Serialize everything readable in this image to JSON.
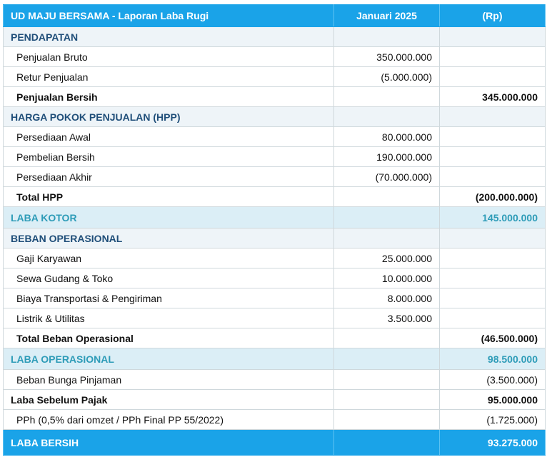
{
  "header": {
    "title": "UD MAJU BERSAMA - Laporan Laba Rugi",
    "period": "Januari 2025",
    "currency": "(Rp)"
  },
  "rows": [
    {
      "kind": "section",
      "label": "PENDAPATAN",
      "detail": "",
      "total": ""
    },
    {
      "kind": "item",
      "label": "Penjualan Bruto",
      "detail": "350.000.000",
      "total": ""
    },
    {
      "kind": "item",
      "label": "Retur Penjualan",
      "detail": "(5.000.000)",
      "total": ""
    },
    {
      "kind": "total",
      "label": "Penjualan Bersih",
      "detail": "",
      "total": "345.000.000"
    },
    {
      "kind": "section",
      "label": "HARGA POKOK PENJUALAN (HPP)",
      "detail": "",
      "total": ""
    },
    {
      "kind": "item",
      "label": "Persediaan Awal",
      "detail": "80.000.000",
      "total": ""
    },
    {
      "kind": "item",
      "label": "Pembelian Bersih",
      "detail": "190.000.000",
      "total": ""
    },
    {
      "kind": "item",
      "label": "Persediaan Akhir",
      "detail": "(70.000.000)",
      "total": ""
    },
    {
      "kind": "total",
      "label": "Total HPP",
      "detail": "",
      "total": "(200.000.000)"
    },
    {
      "kind": "profit",
      "label": "LABA KOTOR",
      "detail": "",
      "total": "145.000.000"
    },
    {
      "kind": "section",
      "label": "BEBAN OPERASIONAL",
      "detail": "",
      "total": ""
    },
    {
      "kind": "item",
      "label": "Gaji Karyawan",
      "detail": "25.000.000",
      "total": ""
    },
    {
      "kind": "item",
      "label": "Sewa Gudang & Toko",
      "detail": "10.000.000",
      "total": ""
    },
    {
      "kind": "item",
      "label": "Biaya Transportasi & Pengiriman",
      "detail": "8.000.000",
      "total": ""
    },
    {
      "kind": "item",
      "label": "Listrik & Utilitas",
      "detail": "3.500.000",
      "total": ""
    },
    {
      "kind": "total",
      "label": "Total Beban Operasional",
      "detail": "",
      "total": "(46.500.000)"
    },
    {
      "kind": "profit",
      "label": "LABA OPERASIONAL",
      "detail": "",
      "total": "98.500.000"
    },
    {
      "kind": "item",
      "label": "Beban Bunga Pinjaman",
      "detail": "",
      "total": "(3.500.000)"
    },
    {
      "kind": "plain-bold",
      "label": "Laba Sebelum Pajak",
      "detail": "",
      "total": "95.000.000"
    },
    {
      "kind": "item",
      "label": "PPh (0,5% dari omzet / PPh Final PP 55/2022)",
      "detail": "",
      "total": "(1.725.000)"
    },
    {
      "kind": "final",
      "label": "LABA BERSIH",
      "detail": "",
      "total": "93.275.000"
    }
  ]
}
